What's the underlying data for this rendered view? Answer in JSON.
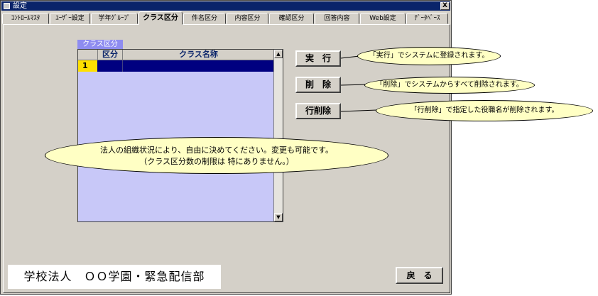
{
  "window": {
    "title": "設定",
    "close_label": "X"
  },
  "tabs": [
    {
      "label": "ｺﾝﾄﾛｰﾙﾏｽﾀ",
      "active": false
    },
    {
      "label": "ﾕｰｻﾞｰ設定",
      "active": false
    },
    {
      "label": "学年ｸﾞﾙｰﾌﾟ",
      "active": false
    },
    {
      "label": "クラス区分",
      "active": true
    },
    {
      "label": "件名区分",
      "active": false
    },
    {
      "label": "内容区分",
      "active": false
    },
    {
      "label": "確認区分",
      "active": false
    },
    {
      "label": "回答内容",
      "active": false
    },
    {
      "label": "Web設定",
      "active": false
    },
    {
      "label": "ﾃﾞｰﾀﾍﾞｰｽ",
      "active": false
    }
  ],
  "grid": {
    "caption": "クラス区分",
    "columns": [
      "区分",
      "クラス名称"
    ],
    "rows": [
      {
        "no": "1",
        "kubun": "",
        "name": ""
      }
    ]
  },
  "buttons": {
    "execute": "実　行",
    "delete": "削　除",
    "delete_row": "行削除",
    "back": "戻　る"
  },
  "callouts": {
    "execute": "「実行」でシステムに登録されます。",
    "delete": "「削除」でシステムからすべて削除されます。",
    "delete_row": "「行削除」で指定した役職名が削除されます。",
    "note_line1": "法人の組織状況により、自由に決めてください。変更も可能です。",
    "note_line2": "（クラス区分数の制限は 特にありません。）"
  },
  "footer": {
    "org_name": "学校法人　ＯＯ学園・緊急配信部"
  },
  "colors": {
    "titlebar": "#0a246a",
    "grid_bg": "#c8c8f8",
    "callout_bg": "#ffffc4",
    "row_number": "#ffe000"
  }
}
